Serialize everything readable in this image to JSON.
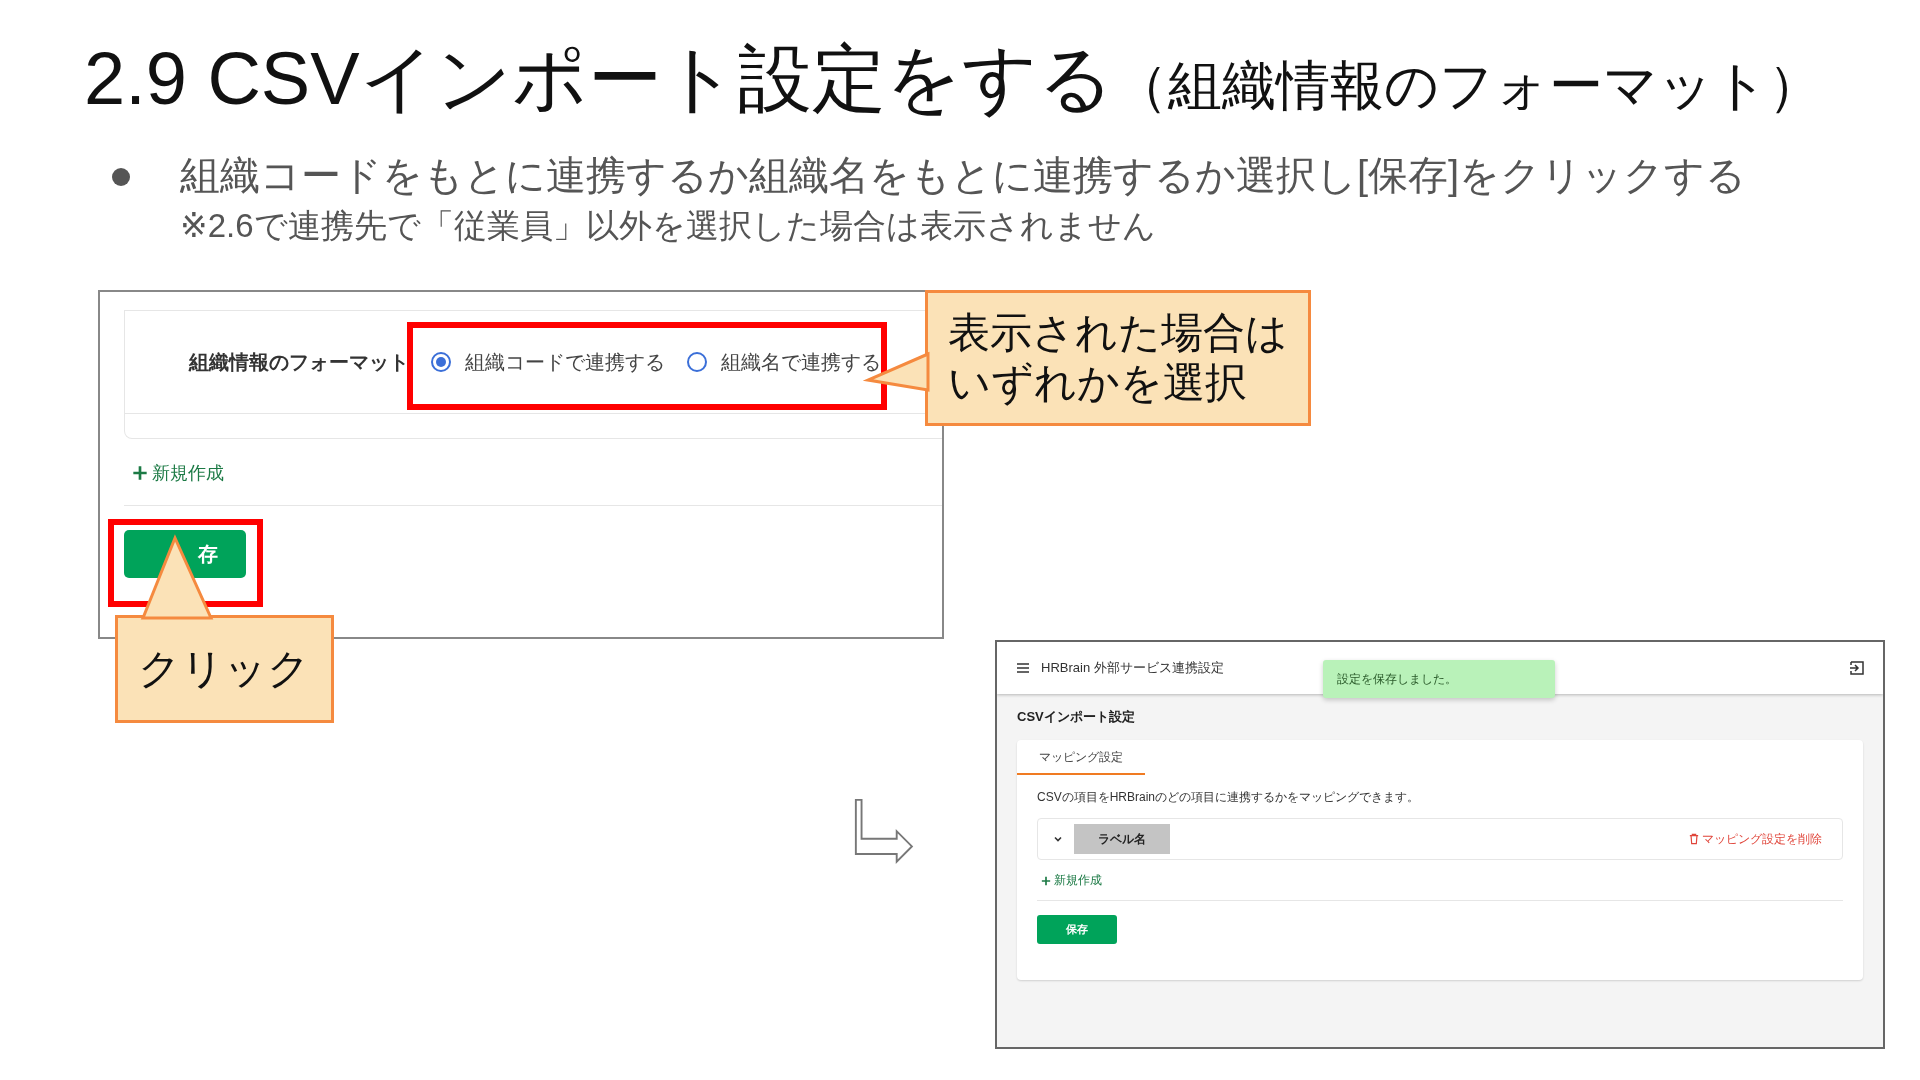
{
  "slide": {
    "title": "2.9 CSVインポート設定をする",
    "title_note": "（組織情報のフォーマット）",
    "bullet": "組織コードをもとに連携するか組織名をもとに連携するか選択し[保存]をクリックする",
    "note": "※2.6で連携先で「従業員」以外を選択した場合は表示されません"
  },
  "before": {
    "field_label": "組織情報のフォーマット",
    "options": [
      {
        "label": "組織コードで連携する",
        "selected": true
      },
      {
        "label": "組織名で連携する",
        "selected": false
      }
    ],
    "add_link": "新規作成",
    "save_button": "存"
  },
  "callouts": [
    {
      "kind": "right",
      "text": "表示された場合はいずれかを選択"
    },
    {
      "kind": "up",
      "text": "クリック"
    }
  ],
  "after": {
    "app_title": "HRBrain 外部サービス連携設定",
    "toast": "設定を保存しました。",
    "page_title": "CSVインポート設定",
    "tabs": [
      {
        "label": "マッピング設定",
        "selected": true
      }
    ],
    "description": "CSVの項目をHRBrainのどの項目に連携するかをマッピングできます。",
    "mapping": {
      "label": "ラベル名",
      "delete_link": "マッピング設定を削除",
      "expanded": false
    },
    "add_link": "新規作成",
    "save_button": "保存"
  }
}
